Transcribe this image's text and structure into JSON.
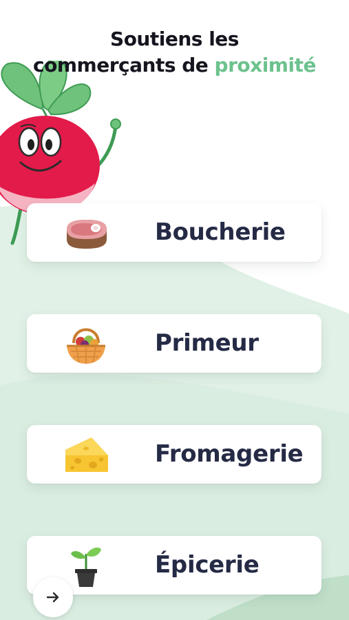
{
  "header": {
    "title_line1": "Soutiens les",
    "title_line2_prefix": "commerçants de ",
    "title_line2_accent": "proximité"
  },
  "shops": [
    {
      "label": "Boucherie",
      "icon": "meat-icon"
    },
    {
      "label": "Primeur",
      "icon": "fruit-basket-icon"
    },
    {
      "label": "Fromagerie",
      "icon": "cheese-icon"
    },
    {
      "label": "Épicerie",
      "icon": "sprout-pot-icon"
    }
  ],
  "navigation": {
    "next_icon": "arrow-right-icon"
  },
  "colors": {
    "accent": "#6cc28d",
    "title": "#15151f",
    "label": "#252a45",
    "background_green": "#dcefe4",
    "mascot_body": "#e31b4a"
  }
}
